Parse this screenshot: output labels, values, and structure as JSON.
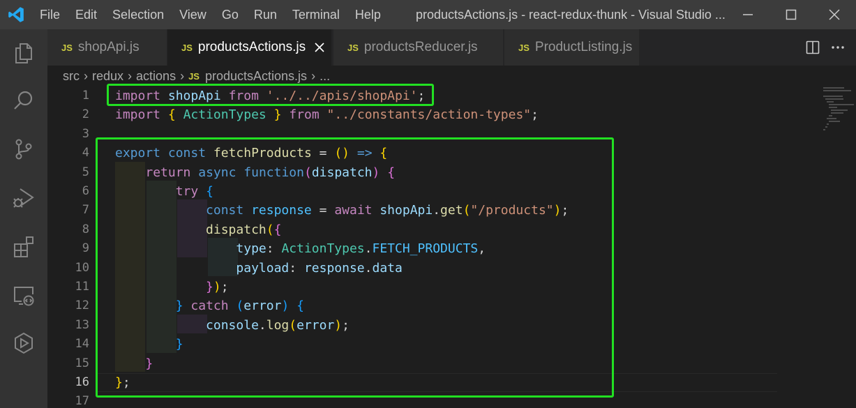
{
  "window": {
    "title": "productsActions.js - react-redux-thunk - Visual Studio ...",
    "menu": [
      "File",
      "Edit",
      "Selection",
      "View",
      "Go",
      "Run",
      "Terminal",
      "Help"
    ]
  },
  "activity_bar": {
    "icons": [
      "explorer-icon",
      "search-icon",
      "source-control-icon",
      "run-debug-icon",
      "extensions-icon",
      "remote-explorer-icon",
      "testing-icon"
    ]
  },
  "tabs": [
    {
      "badge": "JS",
      "label": "shopApi.js",
      "active": false
    },
    {
      "badge": "JS",
      "label": "productsActions.js",
      "active": true
    },
    {
      "badge": "JS",
      "label": "productsReducer.js",
      "active": false
    },
    {
      "badge": "JS",
      "label": "ProductListing.js",
      "active": false
    }
  ],
  "breadcrumb": {
    "parts": [
      "src",
      "redux",
      "actions"
    ],
    "file_badge": "JS",
    "file": "productsActions.js",
    "tail": "..."
  },
  "editor": {
    "line_numbers": [
      "1",
      "2",
      "3",
      "4",
      "5",
      "6",
      "7",
      "8",
      "9",
      "10",
      "11",
      "12",
      "13",
      "14",
      "15",
      "16",
      "17"
    ],
    "active_line": "16",
    "code_lines": [
      "import shopApi from '../../apis/shopApi';",
      "import { ActionTypes } from \"../constants/action-types\";",
      "",
      "export const fetchProducts = () => {",
      "    return async function(dispatch) {",
      "        try {",
      "            const response = await shopApi.get(\"/products\");",
      "            dispatch({",
      "                type: ActionTypes.FETCH_PRODUCTS,",
      "                payload: response.data",
      "            });",
      "        } catch (error) {",
      "            console.log(error);",
      "        }",
      "    }",
      "};",
      ""
    ]
  },
  "colors": {
    "highlight_box": "#22e022",
    "keyword": "#569cd6",
    "control_keyword": "#c586c0",
    "function": "#dcdcaa",
    "variable": "#9cdcfe",
    "string": "#ce9178",
    "constant": "#4fc1ff",
    "type": "#4ec9b0"
  }
}
